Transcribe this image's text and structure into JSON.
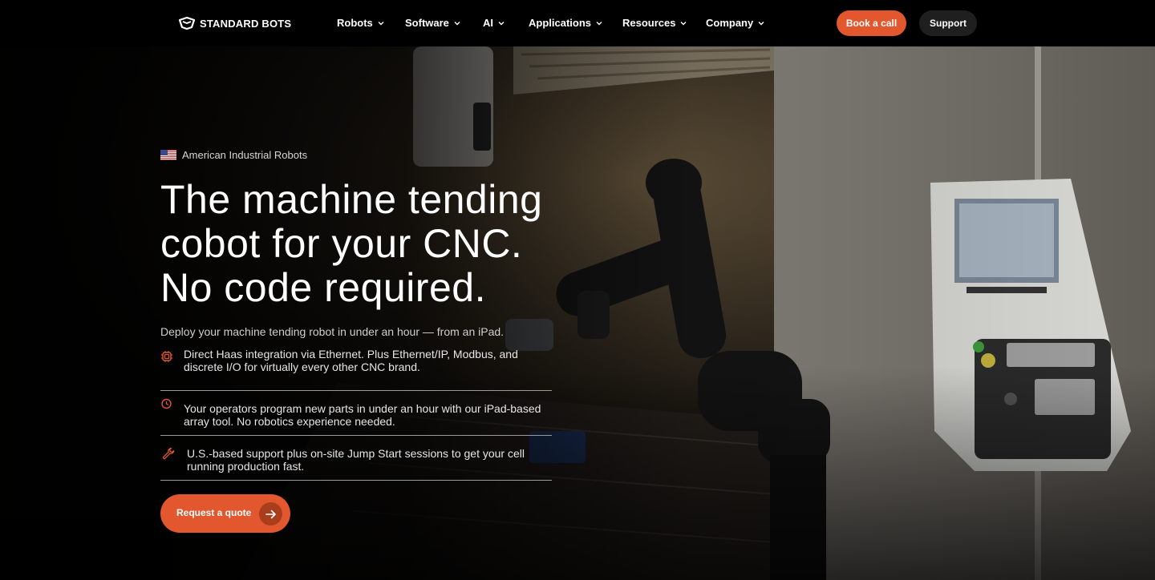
{
  "brand": {
    "name": "STANDARD BOTS"
  },
  "nav": {
    "items": [
      {
        "label": "Robots"
      },
      {
        "label": "Software"
      },
      {
        "label": "AI"
      },
      {
        "label": "Applications"
      },
      {
        "label": "Resources"
      },
      {
        "label": "Company"
      }
    ],
    "book_label": "Book a call",
    "support_label": "Support"
  },
  "hero": {
    "badge": "American Industrial Robots",
    "headline": [
      "The machine tending",
      "cobot for your CNC.",
      "No code required."
    ],
    "subhead": "Deploy your machine tending robot in under an hour — from an iPad.",
    "features": [
      {
        "icon": "chip-icon",
        "text": "Direct Haas integration via Ethernet. Plus Ethernet/IP, Modbus, and discrete I/O for virtually every other CNC brand."
      },
      {
        "icon": "clock-icon",
        "text": "Your operators program new parts in under an hour with our iPad-based array tool. No robotics experience needed."
      },
      {
        "icon": "wrench-icon",
        "text": "U.S.-based support plus on-site Jump Start sessions to get your cell running production fast."
      }
    ],
    "cta_label": "Request a quote"
  },
  "colors": {
    "accent": "#e2572d",
    "accent_dark": "#a93e1d",
    "nav_bg": "#000000",
    "support_bg": "#1f1f1f"
  }
}
